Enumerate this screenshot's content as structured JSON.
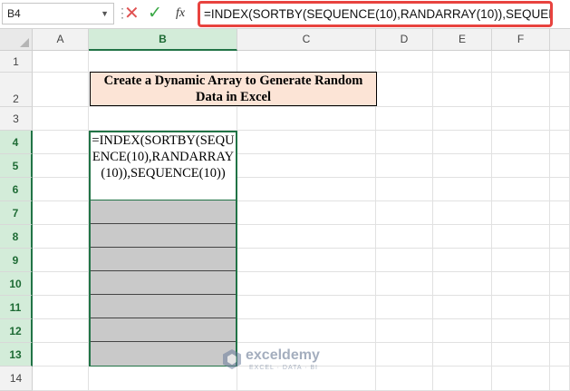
{
  "formula_bar": {
    "name_box": "B4",
    "formula": "=INDEX(SORTBY(SEQUENCE(10),RANDARRAY(10)),SEQUENCE(10))",
    "dots": "⋮",
    "cancel_glyph": "✕",
    "enter_glyph": "✓",
    "fx_label": "fx",
    "icons": [
      "cancel-icon",
      "enter-icon",
      "insert-function-icon"
    ]
  },
  "sheet": {
    "columns": [
      "A",
      "B",
      "C",
      "D",
      "E",
      "F"
    ],
    "selected_column": "B",
    "rows": [
      "1",
      "2",
      "3",
      "4",
      "5",
      "6",
      "7",
      "8",
      "9",
      "10",
      "11",
      "12",
      "13",
      "14"
    ],
    "selected_rows": [
      "4",
      "5",
      "6",
      "7",
      "8",
      "9",
      "10",
      "11",
      "12",
      "13"
    ],
    "title_cell": "Create a Dynamic Array to Generate Random Data in Excel",
    "formula_cell": "=INDEX(SORTBY(SEQUENCE(10),RANDARRAY(10)),SEQUENCE(10))"
  },
  "colors": {
    "accent": "#217346",
    "title_fill": "#fce4d6",
    "highlight_border": "#e8433f",
    "spill_fill": "#c9c9c9"
  },
  "watermark": {
    "name": "exceldemy",
    "tagline": "EXCEL · DATA · BI"
  }
}
